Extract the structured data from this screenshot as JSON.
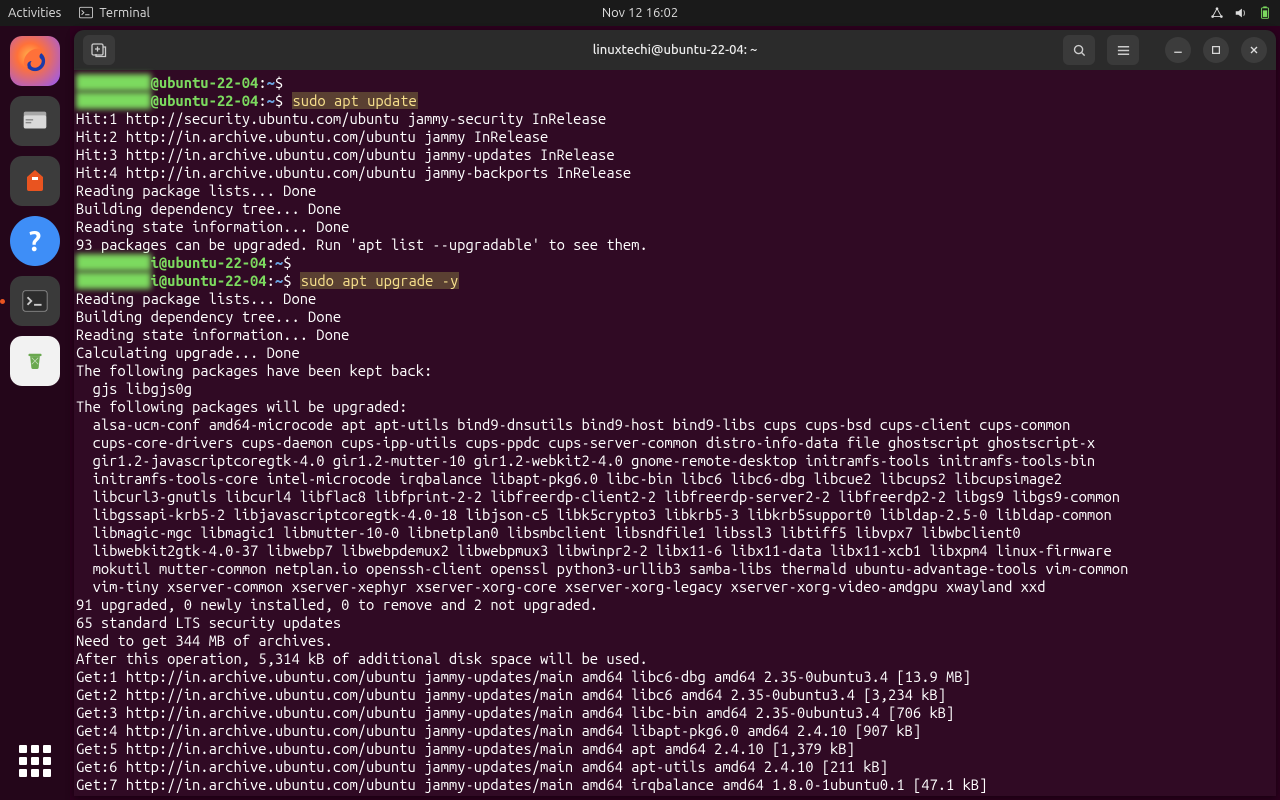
{
  "topbar": {
    "activities": "Activities",
    "terminal_label": "Terminal",
    "datetime": "Nov 12  16:02"
  },
  "window": {
    "title": "linuxtechi@ubuntu-22-04: ~"
  },
  "prompt": {
    "user_blur": "linuxtech",
    "host": "@ubuntu-22-04",
    "path": "~",
    "sep": ":",
    "dollar": "$"
  },
  "cmds": {
    "update": "sudo apt update",
    "upgrade": "sudo apt upgrade -y"
  },
  "update_out": [
    "Hit:1 http://security.ubuntu.com/ubuntu jammy-security InRelease",
    "Hit:2 http://in.archive.ubuntu.com/ubuntu jammy InRelease",
    "Hit:3 http://in.archive.ubuntu.com/ubuntu jammy-updates InRelease",
    "Hit:4 http://in.archive.ubuntu.com/ubuntu jammy-backports InRelease",
    "Reading package lists... Done",
    "Building dependency tree... Done",
    "Reading state information... Done",
    "93 packages can be upgraded. Run 'apt list --upgradable' to see them."
  ],
  "upgrade_hdr": [
    "Reading package lists... Done",
    "Building dependency tree... Done",
    "Reading state information... Done",
    "Calculating upgrade... Done",
    "The following packages have been kept back:",
    "  gjs libgjs0g",
    "The following packages will be upgraded:"
  ],
  "pkg_lines": [
    "  alsa-ucm-conf amd64-microcode apt apt-utils bind9-dnsutils bind9-host bind9-libs cups cups-bsd cups-client cups-common",
    "  cups-core-drivers cups-daemon cups-ipp-utils cups-ppdc cups-server-common distro-info-data file ghostscript ghostscript-x",
    "  gir1.2-javascriptcoregtk-4.0 gir1.2-mutter-10 gir1.2-webkit2-4.0 gnome-remote-desktop initramfs-tools initramfs-tools-bin",
    "  initramfs-tools-core intel-microcode irqbalance libapt-pkg6.0 libc-bin libc6 libc6-dbg libcue2 libcups2 libcupsimage2",
    "  libcurl3-gnutls libcurl4 libflac8 libfprint-2-2 libfreerdp-client2-2 libfreerdp-server2-2 libfreerdp2-2 libgs9 libgs9-common",
    "  libgssapi-krb5-2 libjavascriptcoregtk-4.0-18 libjson-c5 libk5crypto3 libkrb5-3 libkrb5support0 libldap-2.5-0 libldap-common",
    "  libmagic-mgc libmagic1 libmutter-10-0 libnetplan0 libsmbclient libsndfile1 libssl3 libtiff5 libvpx7 libwbclient0",
    "  libwebkit2gtk-4.0-37 libwebp7 libwebpdemux2 libwebpmux3 libwinpr2-2 libx11-6 libx11-data libx11-xcb1 libxpm4 linux-firmware",
    "  mokutil mutter-common netplan.io openssh-client openssl python3-urllib3 samba-libs thermald ubuntu-advantage-tools vim-common",
    "  vim-tiny xserver-common xserver-xephyr xserver-xorg-core xserver-xorg-legacy xserver-xorg-video-amdgpu xwayland xxd"
  ],
  "upgrade_tail": [
    "91 upgraded, 0 newly installed, 0 to remove and 2 not upgraded.",
    "65 standard LTS security updates",
    "Need to get 344 MB of archives.",
    "After this operation, 5,314 kB of additional disk space will be used.",
    "Get:1 http://in.archive.ubuntu.com/ubuntu jammy-updates/main amd64 libc6-dbg amd64 2.35-0ubuntu3.4 [13.9 MB]",
    "Get:2 http://in.archive.ubuntu.com/ubuntu jammy-updates/main amd64 libc6 amd64 2.35-0ubuntu3.4 [3,234 kB]",
    "Get:3 http://in.archive.ubuntu.com/ubuntu jammy-updates/main amd64 libc-bin amd64 2.35-0ubuntu3.4 [706 kB]",
    "Get:4 http://in.archive.ubuntu.com/ubuntu jammy-updates/main amd64 libapt-pkg6.0 amd64 2.4.10 [907 kB]",
    "Get:5 http://in.archive.ubuntu.com/ubuntu jammy-updates/main amd64 apt amd64 2.4.10 [1,379 kB]",
    "Get:6 http://in.archive.ubuntu.com/ubuntu jammy-updates/main amd64 apt-utils amd64 2.4.10 [211 kB]",
    "Get:7 http://in.archive.ubuntu.com/ubuntu jammy-updates/main amd64 irqbalance amd64 1.8.0-1ubuntu0.1 [47.1 kB]"
  ]
}
